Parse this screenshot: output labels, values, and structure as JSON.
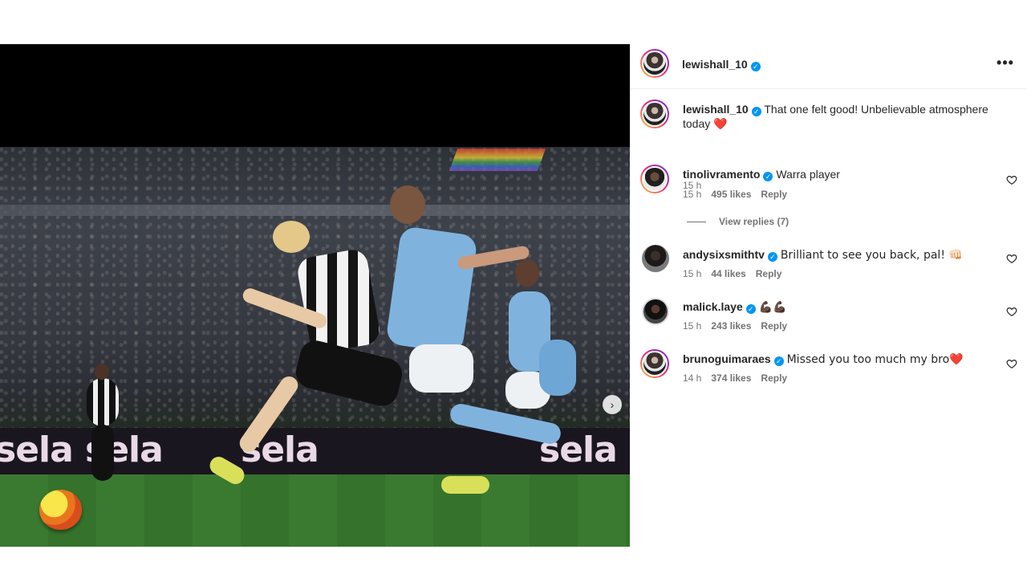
{
  "post": {
    "author": "lewishall_10",
    "ad_words": [
      "sela",
      "sela",
      "sela",
      "sela"
    ]
  },
  "caption": {
    "username": "lewishall_10",
    "text": "That one felt good! Unbelievable atmosphere today",
    "emoji": "❤️",
    "time": "15 h"
  },
  "view_replies": "View replies (7)",
  "comments": [
    {
      "username": "tinolivramento",
      "text": "Warra player",
      "time": "15 h",
      "likes": "495 likes",
      "reply": "Reply"
    },
    {
      "username": "andysixsmithtv",
      "text": "Brilliant to see you back, pal! 👊🏻",
      "time": "15 h",
      "likes": "44 likes",
      "reply": "Reply"
    },
    {
      "username": "malick.laye",
      "text": "💪🏿💪🏿",
      "time": "15 h",
      "likes": "243 likes",
      "reply": "Reply"
    },
    {
      "username": "brunoguimaraes",
      "text": "Missed you too much my bro❤️",
      "time": "14 h",
      "likes": "374 likes",
      "reply": "Reply"
    }
  ],
  "icons": {
    "more": "more-options-icon",
    "verified": "verified-badge-icon",
    "heart": "heart-outline-icon",
    "next": "chevron-right-icon"
  },
  "colors": {
    "verified": "#0095f6",
    "meta_text": "#737373",
    "text": "#262626"
  }
}
